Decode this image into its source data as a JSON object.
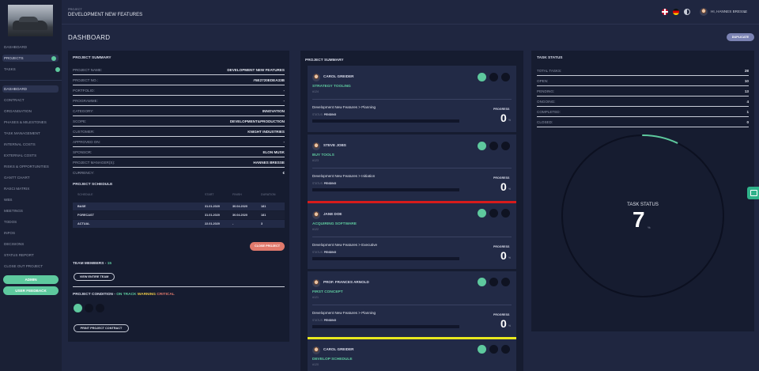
{
  "header": {
    "project_label": "PROJECT",
    "project_name": "DEVELOPMENT NEW FEATURES",
    "greeting": "HI, HANNES BRESSE"
  },
  "nav_top": [
    {
      "label": "DASHBOARD"
    },
    {
      "label": "PROJECTS"
    },
    {
      "label": "TASKS"
    }
  ],
  "nav_project": [
    {
      "label": "DASHBOARD"
    },
    {
      "label": "CONTRACT"
    },
    {
      "label": "ORGANISATION"
    },
    {
      "label": "PHASES & MILESTONES"
    },
    {
      "label": "TASK MANAGEMENT"
    },
    {
      "label": "INTERNAL COSTS"
    },
    {
      "label": "EXTERNAL COSTS"
    },
    {
      "label": "RISKS & OPPORTUNITIES"
    },
    {
      "label": "GANTT CHART"
    },
    {
      "label": "RASCI MATRIX"
    },
    {
      "label": "WBS"
    },
    {
      "label": "MEETINGS"
    },
    {
      "label": "TODOS"
    },
    {
      "label": "INFOS"
    },
    {
      "label": "DECISIONS"
    },
    {
      "label": "STATUS REPORT"
    },
    {
      "label": "CLOSE OUT PROJECT"
    }
  ],
  "side_buttons": {
    "admin": "ADMIN",
    "feedback": "USER FEEDBACK"
  },
  "page": {
    "title": "DASHBOARD",
    "duplicate": "DUPLICATE"
  },
  "summary": {
    "title": "PROJECT SUMMARY",
    "rows": [
      {
        "k": "PROJECT NAME:",
        "v": "DEVELOPMENT NEW FEATURES"
      },
      {
        "k": "PROJECT NO.:",
        "v": "#5E2720EDEA33B"
      },
      {
        "k": "PORTFOLIO:",
        "v": "-"
      },
      {
        "k": "PROGRAMME:",
        "v": "-"
      },
      {
        "k": "CATEGORY:",
        "v": "INNOVATION"
      },
      {
        "k": "SCOPE:",
        "v": "DEVELOPMENT&PRODUCTION"
      },
      {
        "k": "CUSTOMER:",
        "v": "KNIGHT INDUSTRIES"
      },
      {
        "k": "APPROVED ON:",
        "v": "-"
      },
      {
        "k": "SPONSOR:",
        "v": "ELON MUSK"
      },
      {
        "k": "PROJECT MANAGER(S):",
        "v": "HANNES BRESSE"
      },
      {
        "k": "CURRENCY:",
        "v": "€"
      }
    ]
  },
  "schedule": {
    "title": "PROJECT SCHEDULE",
    "headers": [
      "SCHEDULE",
      "START",
      "FINISH",
      "DURATION"
    ],
    "rows": [
      {
        "name": "BASE",
        "start": "31.01.2020",
        "finish": "30.04.2020",
        "duration": "181"
      },
      {
        "name": "FORECAST",
        "start": "31.01.2020",
        "finish": "30.04.2020",
        "duration": "181"
      },
      {
        "name": "ACTUAL",
        "start": "22.01.2020",
        "finish": "-",
        "duration": "3"
      }
    ]
  },
  "close_project": "CLOSE PROJECT",
  "team": {
    "label": "TEAM MEMBERS -",
    "count": "15",
    "view": "VIEW ENTIRE TEAM"
  },
  "condition": {
    "label": "PROJECT CONDITION -",
    "on_track": "ON TRACK",
    "warning": "WARNING",
    "critical": "CRITICAL"
  },
  "print_contract": "PRINT PROJECT CONTRACT",
  "center": {
    "title": "PROJECT SUMMARY",
    "progress_label": "PROGRESS",
    "status_label": "STATUS:",
    "cards": [
      {
        "name": "CAROL GREIDER",
        "task": "STRATEGY TOOLING",
        "id": "#124",
        "path": "Development New Features > Planning",
        "status": "PENDING",
        "progress": "0",
        "pct": "%"
      },
      {
        "name": "STEVE JOBS",
        "task": "BUY TOOLS",
        "id": "#123",
        "path": "Development New Features > Initiation",
        "status": "PENDING",
        "progress": "0",
        "pct": "%"
      },
      {
        "name": "JANE DOE",
        "task": "ACQUIRING SOFTWARE",
        "id": "#122",
        "path": "Development New Features > Executive",
        "status": "PENDING",
        "progress": "0",
        "pct": "%"
      },
      {
        "name": "PROF. FRANCES ARNOLD",
        "task": "FIRST CONCEPT",
        "id": "#121",
        "path": "Development New Features > Planning",
        "status": "PENDING",
        "progress": "0",
        "pct": "%"
      },
      {
        "name": "CAROL GREIDER",
        "task": "DEVELOP SCHEDULE",
        "id": "#120"
      }
    ]
  },
  "task_status": {
    "title": "TASK STATUS",
    "rows": [
      {
        "k": "TOTAL TASKS:",
        "v": "28"
      },
      {
        "k": "OPEN:",
        "v": "10"
      },
      {
        "k": "PENDING:",
        "v": "13"
      },
      {
        "k": "ONGOING:",
        "v": "4"
      },
      {
        "k": "COMPLETED:",
        "v": "1"
      },
      {
        "k": "CLOSED:",
        "v": "0"
      }
    ],
    "gauge_label": "TASK STATUS",
    "gauge_value": "7",
    "gauge_unit": "%",
    "gauge_fraction": 0.07
  },
  "colors": {
    "green": "#5ec99e",
    "red": "#d71b1b",
    "yellow": "#e8e81e",
    "orange": "#e0796c",
    "panel": "#161c30"
  }
}
